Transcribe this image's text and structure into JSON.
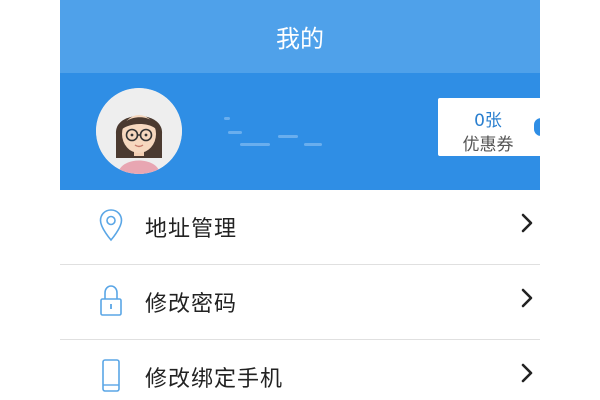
{
  "header": {
    "title": "我的"
  },
  "profile": {
    "avatar_icon": "user-avatar-icon",
    "coupon": {
      "count": "0张",
      "label": "优惠券"
    }
  },
  "menu": {
    "items": [
      {
        "label": "地址管理",
        "icon": "location-pin-icon"
      },
      {
        "label": "修改密码",
        "icon": "lock-icon"
      },
      {
        "label": "修改绑定手机",
        "icon": "phone-icon"
      }
    ]
  },
  "colors": {
    "titlebar": "#4fa1ea",
    "profile_bg": "#2f8ee5",
    "accent": "#2a7fcf",
    "icon": "#5aa6e6"
  }
}
